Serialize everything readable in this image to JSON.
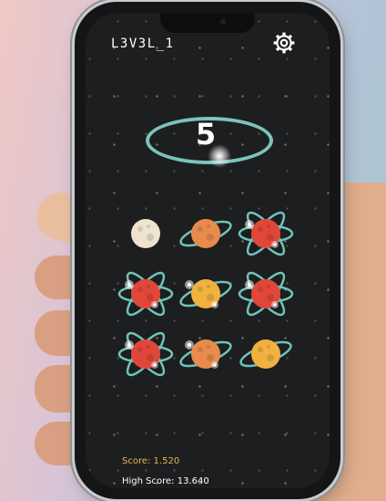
{
  "level": {
    "label": "L3V3L_1"
  },
  "counter": {
    "value": "5"
  },
  "icons": {
    "settings": "gear-icon"
  },
  "grid": {
    "cells": [
      {
        "kind": "beige",
        "orbit": false,
        "sparkle": false
      },
      {
        "kind": "orange",
        "orbit": true,
        "sparkle": false
      },
      {
        "kind": "red",
        "orbit": true,
        "sparkle": true
      },
      {
        "kind": "red",
        "orbit": true,
        "sparkle": true
      },
      {
        "kind": "yellow",
        "orbit": true,
        "sparkle": true
      },
      {
        "kind": "red",
        "orbit": true,
        "sparkle": true
      },
      {
        "kind": "red",
        "orbit": true,
        "sparkle": true
      },
      {
        "kind": "orange",
        "orbit": true,
        "sparkle": true
      },
      {
        "kind": "yellow",
        "orbit": true,
        "sparkle": false
      }
    ]
  },
  "colors": {
    "beige": "#efe2cf",
    "orange": "#e88b4c",
    "red": "#e0473a",
    "yellow": "#f0b13f",
    "orbit": "#6fc4b8",
    "score": "#e6b653"
  },
  "footer": {
    "score_label": "Score: 1.520",
    "high_score_label": "High Score: 13.640"
  }
}
